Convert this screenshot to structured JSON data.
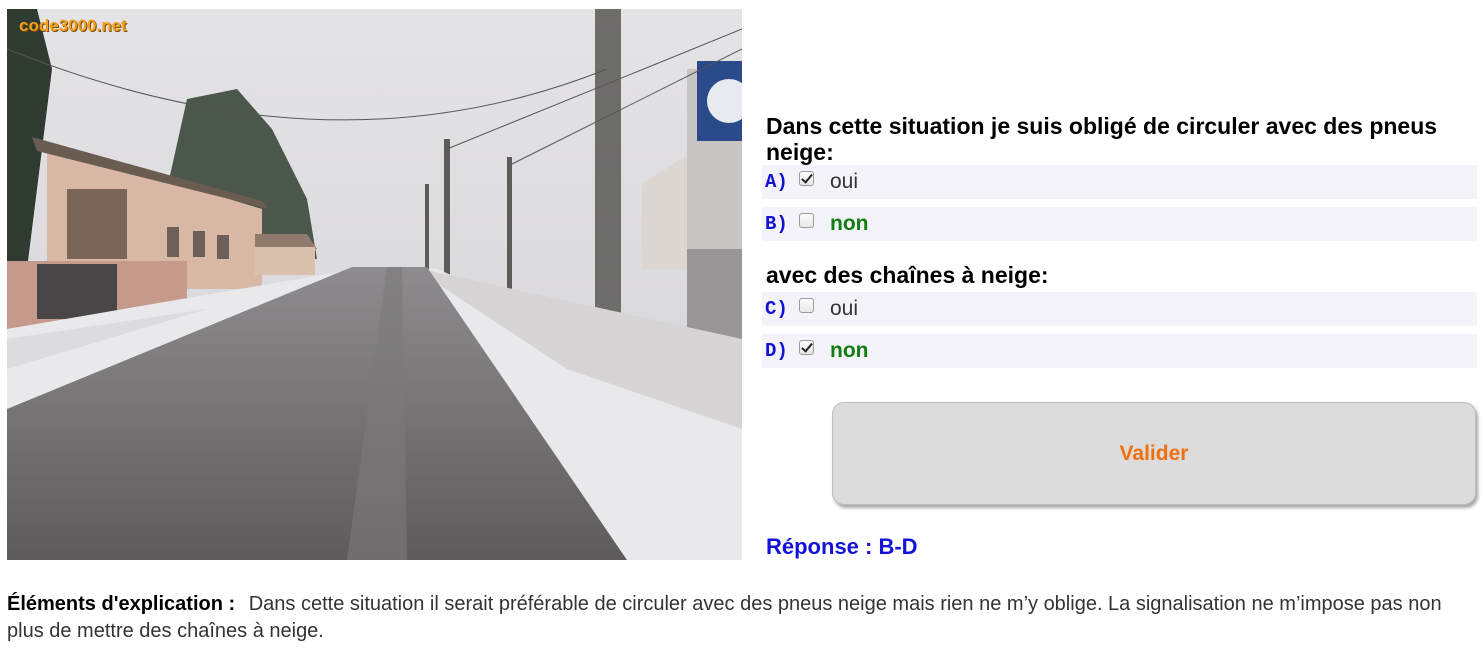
{
  "photo": {
    "watermark": "code3000.net"
  },
  "question1": {
    "text": "Dans cette situation je suis obligé de circuler avec des pneus neige:",
    "options": [
      {
        "letter": "A)",
        "label": "oui",
        "checked": true
      },
      {
        "letter": "B)",
        "label": "non",
        "checked": false
      }
    ]
  },
  "question2": {
    "text": "avec des chaînes à neige:",
    "options": [
      {
        "letter": "C)",
        "label": "oui",
        "checked": false
      },
      {
        "letter": "D)",
        "label": "non",
        "checked": true
      }
    ]
  },
  "validate_label": "Valider",
  "answer": "Réponse : B-D",
  "explanation": {
    "label": "Éléments d'explication :",
    "text": "Dans cette situation il serait préférable de circuler avec des pneus neige mais rien ne m’y oblige. La signalisation ne m’impose pas non plus de mettre des chaînes à neige."
  },
  "colors": {
    "question_text": "#000000",
    "option_letter": "#1212d6",
    "correct_label": "#0f7d0f",
    "button_text": "#f07010",
    "answer_text": "#1313d8",
    "option_row_bg": "#f3f3f9"
  }
}
